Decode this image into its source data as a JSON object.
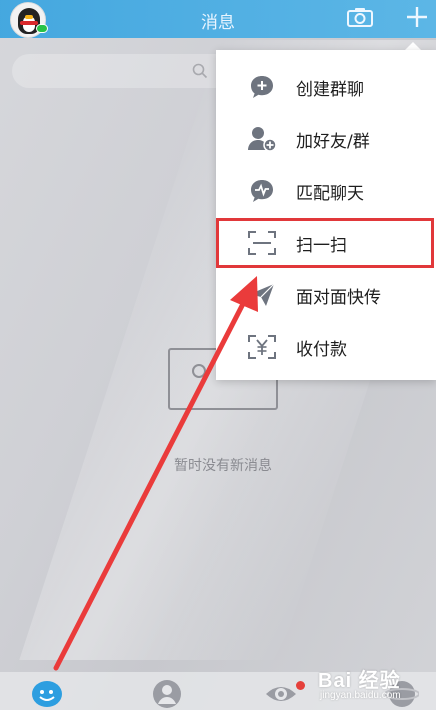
{
  "header": {
    "title": "消息",
    "avatar_icon": "qq-penguin-avatar-icon",
    "camera_icon": "camera-icon",
    "add_icon": "plus-icon",
    "accent_color": "#2b9fe0"
  },
  "search": {
    "icon": "search-icon"
  },
  "empty_state": {
    "text": "暂时没有新消息"
  },
  "menu": {
    "items": [
      {
        "label": "创建群聊",
        "icon": "create-group-icon"
      },
      {
        "label": "加好友/群",
        "icon": "add-friend-icon"
      },
      {
        "label": "匹配聊天",
        "icon": "match-chat-icon"
      },
      {
        "label": "扫一扫",
        "icon": "scan-icon",
        "highlighted": true
      },
      {
        "label": "面对面快传",
        "icon": "face-to-face-transfer-icon"
      },
      {
        "label": "收付款",
        "icon": "payment-icon"
      }
    ],
    "highlight_color": "#e1383a"
  },
  "tabbar": {
    "items": [
      {
        "icon": "messages-tab-icon"
      },
      {
        "icon": "contacts-tab-icon"
      },
      {
        "icon": "discover-tab-icon"
      },
      {
        "icon": "dynamic-tab-icon"
      }
    ]
  },
  "watermark": {
    "main": "Bai 经验",
    "sub": "jingyan.baidu.com"
  }
}
